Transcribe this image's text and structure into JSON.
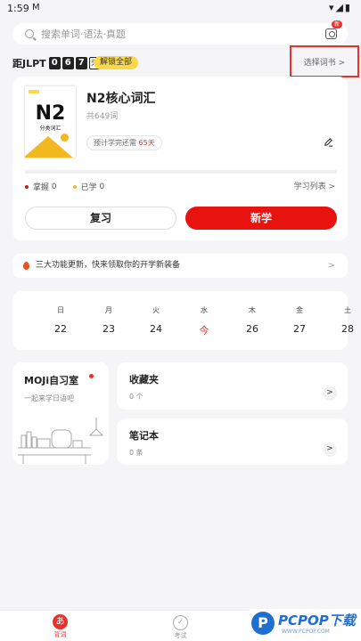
{
  "status": {
    "time": "1:59",
    "mail": "M",
    "icons": "▾◢▮"
  },
  "search": {
    "placeholder": "搜索单词·语法·真题",
    "camera_badge": "新"
  },
  "countdown": {
    "prefix": "距JLPT",
    "digits": [
      "0",
      "6",
      "7"
    ],
    "unit": "天",
    "unlock_label": "解锁全部"
  },
  "select_book": {
    "label": "选择词书 >"
  },
  "book": {
    "cover_title": "N2",
    "cover_subtitle": "分类词汇",
    "title": "N2核心词汇",
    "count": "共649词",
    "eta_prefix": "预计学完还需",
    "eta_days": "65天",
    "progress": 0,
    "mastered_label": "掌握",
    "mastered_value": "0",
    "learned_label": "已学",
    "learned_value": "0",
    "list_link": "学习列表 >",
    "review_label": "复习",
    "new_label": "新学",
    "colors": {
      "accent": "#e8120f",
      "mastered_dot": "#c01b17",
      "learned_dot": "#f0b71c"
    }
  },
  "notice": {
    "text": "三大功能更新，快来领取你的开学新装备",
    "chevron": ">"
  },
  "calendar": {
    "weekdays": [
      "日",
      "月",
      "火",
      "水",
      "木",
      "金",
      "土"
    ],
    "dates": [
      "22",
      "23",
      "24",
      "今",
      "26",
      "27",
      "28"
    ],
    "today_index": 3
  },
  "study_room": {
    "title": "MOJi自习室",
    "subtitle": "一起来学日语吧"
  },
  "favorites": {
    "title": "收藏夹",
    "count": "0 个",
    "chevron": ">"
  },
  "notebook": {
    "title": "笔记本",
    "count": "0 条",
    "chevron": ">"
  },
  "tabbar": {
    "tabs": [
      {
        "label": "背词",
        "icon": "あ",
        "active": true
      },
      {
        "label": "考试",
        "icon": "✓",
        "active": false
      },
      {
        "label": "我的",
        "icon": "",
        "active": false
      }
    ]
  },
  "watermark": {
    "logo": "P",
    "text": "PCPOP下载",
    "url": "WWW.PCPOP.COM"
  }
}
